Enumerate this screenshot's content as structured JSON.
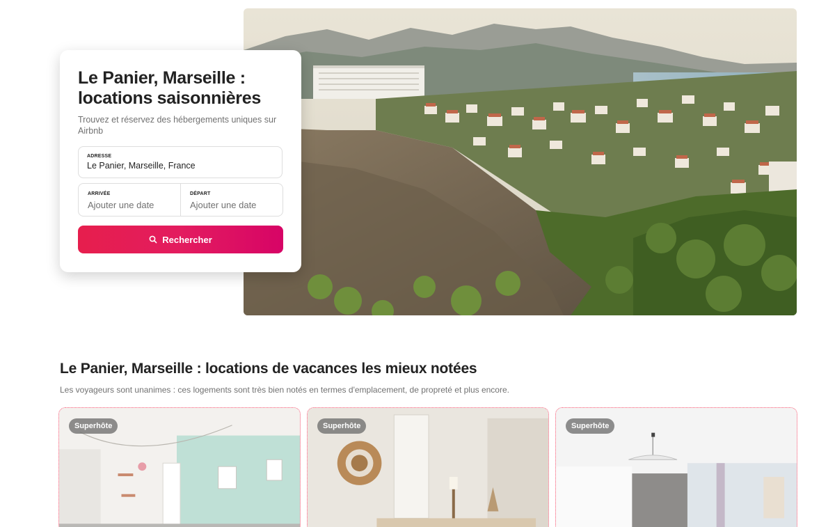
{
  "hero": {
    "title": "Le Panier, Marseille : locations saisonnières",
    "subtitle": "Trouvez et réservez des hébergements uniques sur Airbnb",
    "address": {
      "label": "ADRESSE",
      "value": "Le Panier, Marseille, France"
    },
    "checkin": {
      "label": "ARRIVÉE",
      "placeholder": "Ajouter une date"
    },
    "checkout": {
      "label": "DÉPART",
      "placeholder": "Ajouter une date"
    },
    "search_button": {
      "label": "Rechercher",
      "icon": "search-icon"
    }
  },
  "section": {
    "title": "Le Panier, Marseille : locations de vacances les mieux notées",
    "subtitle": "Les voyageurs sont unanimes : ces logements sont très bien notés en termes d'emplacement, de propreté et plus encore."
  },
  "listings": [
    {
      "badge": "Superhôte"
    },
    {
      "badge": "Superhôte"
    },
    {
      "badge": "Superhôte"
    }
  ],
  "colors": {
    "accent": "#e31c5f",
    "text_primary": "#222222",
    "text_secondary": "#717171"
  }
}
